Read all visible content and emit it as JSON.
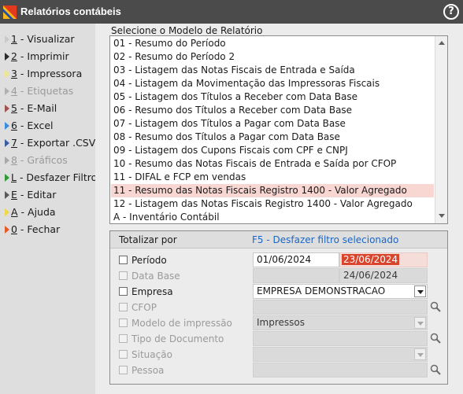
{
  "window": {
    "title": "Relatórios contábeis",
    "help_glyph": "?"
  },
  "sidebar": {
    "items": [
      {
        "key": "1",
        "label": " - Visualizar",
        "arrow_color": "#c9c9c9",
        "disabled": false
      },
      {
        "key": "2",
        "label": " - Imprimir",
        "arrow_color": "#2a2a2a",
        "disabled": false
      },
      {
        "key": "3",
        "label": " - Impressora",
        "arrow_color": "#f0e68c",
        "disabled": false
      },
      {
        "key": "4",
        "label": " - Etiquetas",
        "arrow_color": "#b0b0b0",
        "disabled": true
      },
      {
        "key": "5",
        "label": " - E-Mail",
        "arrow_color": "#a0524f",
        "disabled": false
      },
      {
        "key": "6",
        "label": " - Excel",
        "arrow_color": "#3b8ed8",
        "disabled": false
      },
      {
        "key": "7",
        "label": " - Exportar .CSV",
        "arrow_color": "#3a5ea0",
        "disabled": false
      },
      {
        "key": "8",
        "label": " - Gráficos",
        "arrow_color": "#a8a8a8",
        "disabled": true
      },
      {
        "key": "L",
        "label": " - Desfazer Filtros",
        "arrow_color": "#2f9a3a",
        "disabled": false
      },
      {
        "key": "E",
        "label": " - Editar",
        "arrow_color": "#5a5a5a",
        "disabled": false
      },
      {
        "key": "A",
        "label": " - Ajuda",
        "arrow_color": "#f0d64a",
        "disabled": false
      },
      {
        "key": "0",
        "label": " - Fechar",
        "arrow_color": "#e25c2a",
        "disabled": false
      }
    ]
  },
  "report_model": {
    "label": "Selecione o Modelo de Relatório",
    "items": [
      "01 - Resumo do Período",
      "02 - Resumo do Período 2",
      "03 - Listagem das Notas Fiscais de Entrada e Saída",
      "04 - Listagem da Movimentação das Impressoras Fiscais",
      "05 - Listagem dos Títulos  a Receber com Data Base",
      "06 - Resumo dos Títulos  a Receber com Data Base",
      "07 - Listagem dos Títulos  a Pagar com Data Base",
      "08 - Resumo dos Títulos  a Pagar com Data Base",
      "09 - Listagem dos Cupons Fiscais com CPF e CNPJ",
      "10 - Resumo das Notas Fiscais de Entrada e Saída por CFOP",
      "11 - DIFAL e FCP em vendas",
      "11 - Resumo das Notas Fiscais Registro 1400 - Valor Agregado",
      "12 - Listagem das Notas Fiscais Registro 1400 - Valor Agregado",
      "A - Inventário Contábil"
    ],
    "selected_index": 11
  },
  "totalizar": {
    "label": "Totalizar por",
    "undo_link": "F5 - Desfazer filtro selecionado",
    "periodo": {
      "label": "Período",
      "from": "01/06/2024",
      "to": "23/06/2024"
    },
    "data_base": {
      "label": "Data Base",
      "value": "24/06/2024"
    },
    "empresa": {
      "label": "Empresa",
      "value": "EMPRESA DEMONSTRACAO"
    },
    "cfop": {
      "label": "CFOP"
    },
    "modelo_impressao": {
      "label": "Modelo de impressão",
      "value": "Impressos"
    },
    "tipo_documento": {
      "label": "Tipo de Documento"
    },
    "situacao": {
      "label": "Situação"
    },
    "pessoa": {
      "label": "Pessoa"
    }
  }
}
